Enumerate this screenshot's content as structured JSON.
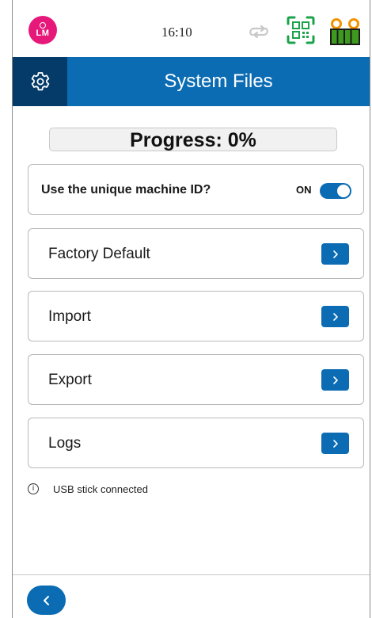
{
  "status_bar": {
    "avatar_initials": "LM",
    "time": "16:10",
    "icons": [
      "user-icon",
      "sync-icon",
      "qr-code-icon",
      "battery-icon"
    ]
  },
  "header": {
    "settings_icon": "gear-icon",
    "title": "System Files"
  },
  "progress": {
    "label": "Progress: 0%",
    "value_percent": 0
  },
  "toggle_option": {
    "label": "Use the unique machine ID?",
    "state_text": "ON",
    "enabled": true
  },
  "menu": {
    "items": [
      {
        "label": "Factory Default",
        "icon": "chevron-right-icon"
      },
      {
        "label": "Import",
        "icon": "chevron-right-icon"
      },
      {
        "label": "Export",
        "icon": "chevron-right-icon"
      },
      {
        "label": "Logs",
        "icon": "chevron-right-icon"
      }
    ]
  },
  "info": {
    "icon": "info-icon",
    "text": "USB stick connected"
  },
  "footer": {
    "back_icon": "chevron-left-icon"
  },
  "colors": {
    "primary_blue": "#0b6cb4",
    "dark_blue": "#053b69",
    "avatar_pink": "#e6197b",
    "qr_green": "#1aa34a",
    "battery_green": "#3d9a1f",
    "battery_orange": "#f39200"
  }
}
